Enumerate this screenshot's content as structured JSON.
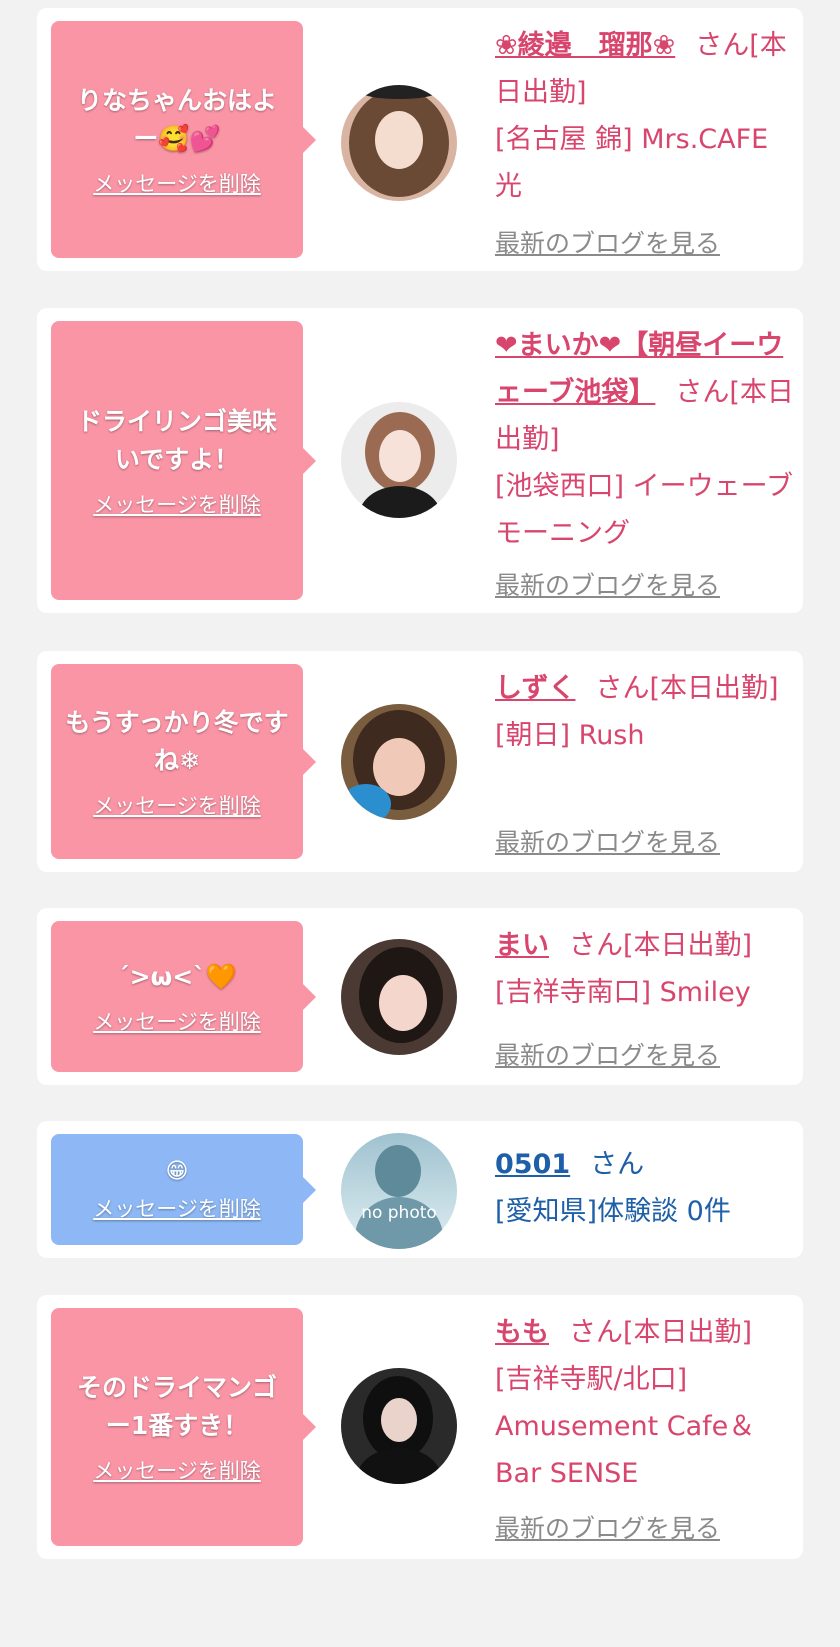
{
  "cards": [
    {
      "message": "りなちゃんおはよー🥰💕",
      "delete_label": "メッセージを削除",
      "name": "❀綾邉　瑠那❀",
      "suffix": "さん[本日出勤]",
      "shop": "[名古屋 錦] Mrs.CAFE光",
      "blog_label": "最新のブログを見る"
    },
    {
      "message": "ドライリンゴ美味いですよ！",
      "delete_label": "メッセージを削除",
      "name": "❤まいか❤【朝昼イーウェーブ池袋】",
      "suffix": "さん[本日出勤]",
      "shop": "[池袋西口] イーウェーブモーニング",
      "blog_label": "最新のブログを見る"
    },
    {
      "message": "もうすっかり冬ですね❄",
      "delete_label": "メッセージを削除",
      "name": "しずく",
      "suffix": "さん[本日出勤]",
      "shop": "[朝日] Rush",
      "blog_label": "最新のブログを見る"
    },
    {
      "message": "´>ω<`🧡",
      "delete_label": "メッセージを削除",
      "name": "まい",
      "suffix": "さん[本日出勤]",
      "shop": "[吉祥寺南口] Smiley",
      "blog_label": "最新のブログを見る"
    },
    {
      "message": "😁",
      "delete_label": "メッセージを削除",
      "name": "0501",
      "suffix": "さん",
      "shop": "[愛知県]体験談 0件",
      "avatar_text": "no photo"
    },
    {
      "message": "そのドライマンゴー1番すき！",
      "delete_label": "メッセージを削除",
      "name": "もも",
      "suffix": "さん[本日出勤]",
      "shop": "[吉祥寺駅/北口] Amusement Cafe＆Bar SENSE",
      "blog_label": "最新のブログを見る"
    }
  ],
  "colors": {
    "pink_bubble": "#fa95a6",
    "blue_bubble": "#8db8f5",
    "pink_text": "#d8456d",
    "blue_text": "#1e5fa8"
  }
}
